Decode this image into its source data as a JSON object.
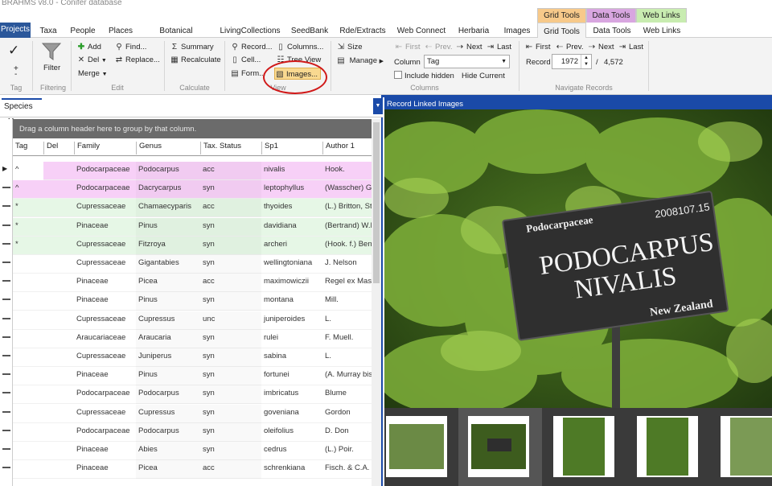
{
  "title": "BRAHMS v8.0 - Conifer database",
  "context_tabs": [
    {
      "label": "Grid Tools",
      "color": "#f7c98a"
    },
    {
      "label": "Data Tools",
      "color": "#d8a6e0"
    },
    {
      "label": "Web Links",
      "color": "#c8ecb0"
    }
  ],
  "ribbon_tabs": [
    "Projects",
    "Taxa",
    "People",
    "Places",
    "Botanical Records",
    "LivingCollections",
    "SeedBank",
    "Rde/Extracts",
    "Web Connect",
    "Herbaria",
    "Images",
    "Grid Tools",
    "Data Tools",
    "Web Links"
  ],
  "ribbon": {
    "tag": {
      "label": "Tag",
      "plus": "+",
      "minus": "-",
      "check": "✓"
    },
    "filtering": {
      "label": "Filtering",
      "filter": "Filter"
    },
    "edit": {
      "label": "Edit",
      "add": "Add",
      "del": "Del",
      "merge": "Merge",
      "find": "Find...",
      "replace": "Replace..."
    },
    "calculate": {
      "label": "Calculate",
      "summary": "Summary",
      "recalculate": "Recalculate"
    },
    "view": {
      "label": "View",
      "record": "Record...",
      "columns": "Columns...",
      "cell": "Cell...",
      "tree": "Tree View",
      "form": "Form...",
      "images": "Images..."
    },
    "columns": {
      "label": "Columns",
      "size": "Size",
      "manage": "Manage",
      "column": "Column",
      "column_value": "Tag",
      "include_hidden": "Include hidden",
      "hide_current": "Hide Current",
      "first": "First",
      "prev": "Prev.",
      "next": "Next",
      "last": "Last"
    },
    "navigate": {
      "label": "Navigate Records",
      "first": "First",
      "prev": "Prev.",
      "next": "Next",
      "last": "Last",
      "record": "Record",
      "record_value": "1972",
      "sep": "/",
      "total": "4,572"
    }
  },
  "species_tab": "Species",
  "group_hint": "Drag a column header here to group by that column.",
  "columns": [
    "Tag",
    "Del",
    "Family",
    "Genus",
    "Tax. Status",
    "Sp1",
    "Author 1"
  ],
  "rows": [
    {
      "tag": "^",
      "del": "",
      "family": "Podocarpaceae",
      "genus": "Podocarpus",
      "status": "acc",
      "sp1": "nivalis",
      "author": "Hook.",
      "bg": "#f7d0f7"
    },
    {
      "tag": "^",
      "del": "",
      "family": "Podocarpaceae",
      "genus": "Dacrycarpus",
      "status": "syn",
      "sp1": "leptophyllus",
      "author": "(Wasscher) Ga",
      "bg": "#f7d0f7"
    },
    {
      "tag": "*",
      "del": "",
      "family": "Cupressaceae",
      "genus": "Chamaecyparis",
      "status": "acc",
      "sp1": "thyoides",
      "author": "(L.) Britton, Ste",
      "bg": "#e6f7e6"
    },
    {
      "tag": "*",
      "del": "",
      "family": "Pinaceae",
      "genus": "Pinus",
      "status": "syn",
      "sp1": "davidiana",
      "author": "(Bertrand) W.F",
      "bg": "#e6f7e6"
    },
    {
      "tag": "*",
      "del": "",
      "family": "Cupressaceae",
      "genus": "Fitzroya",
      "status": "syn",
      "sp1": "archeri",
      "author": "(Hook. f.) Bent",
      "bg": "#e6f7e6"
    },
    {
      "tag": "",
      "del": "",
      "family": "Cupressaceae",
      "genus": "Gigantabies",
      "status": "syn",
      "sp1": "wellingtoniana",
      "author": "J. Nelson",
      "bg": "#ffffff"
    },
    {
      "tag": "",
      "del": "",
      "family": "Pinaceae",
      "genus": "Picea",
      "status": "acc",
      "sp1": "maximowiczii",
      "author": "Regel ex Mast",
      "bg": "#ffffff"
    },
    {
      "tag": "",
      "del": "",
      "family": "Pinaceae",
      "genus": "Pinus",
      "status": "syn",
      "sp1": "montana",
      "author": "Mill.",
      "bg": "#ffffff"
    },
    {
      "tag": "",
      "del": "",
      "family": "Cupressaceae",
      "genus": "Cupressus",
      "status": "unc",
      "sp1": "juniperoides",
      "author": "L.",
      "bg": "#ffffff"
    },
    {
      "tag": "",
      "del": "",
      "family": "Araucariaceae",
      "genus": "Araucaria",
      "status": "syn",
      "sp1": "rulei",
      "author": "F. Muell.",
      "bg": "#ffffff"
    },
    {
      "tag": "",
      "del": "",
      "family": "Cupressaceae",
      "genus": "Juniperus",
      "status": "syn",
      "sp1": "sabina",
      "author": "L.",
      "bg": "#ffffff"
    },
    {
      "tag": "",
      "del": "",
      "family": "Pinaceae",
      "genus": "Pinus",
      "status": "syn",
      "sp1": "fortunei",
      "author": "(A. Murray bis",
      "bg": "#ffffff"
    },
    {
      "tag": "",
      "del": "",
      "family": "Podocarpaceae",
      "genus": "Podocarpus",
      "status": "syn",
      "sp1": "imbricatus",
      "author": "Blume",
      "bg": "#ffffff"
    },
    {
      "tag": "",
      "del": "",
      "family": "Cupressaceae",
      "genus": "Cupressus",
      "status": "syn",
      "sp1": "goveniana",
      "author": "Gordon",
      "bg": "#ffffff"
    },
    {
      "tag": "",
      "del": "",
      "family": "Podocarpaceae",
      "genus": "Podocarpus",
      "status": "syn",
      "sp1": "oleifolius",
      "author": "D. Don",
      "bg": "#ffffff"
    },
    {
      "tag": "",
      "del": "",
      "family": "Pinaceae",
      "genus": "Abies",
      "status": "syn",
      "sp1": "cedrus",
      "author": "(L.) Poir.",
      "bg": "#ffffff"
    },
    {
      "tag": "",
      "del": "",
      "family": "Pinaceae",
      "genus": "Picea",
      "status": "acc",
      "sp1": "schrenkiana",
      "author": "Fisch. & C.A. M",
      "bg": "#ffffff"
    }
  ],
  "right_panel": {
    "title": "Record Linked Images",
    "sign": {
      "family": "Podocarpaceae",
      "number": "2008107.15",
      "line1": "PODOCARPUS",
      "line2": "NIVALIS",
      "country": "New Zealand"
    }
  }
}
